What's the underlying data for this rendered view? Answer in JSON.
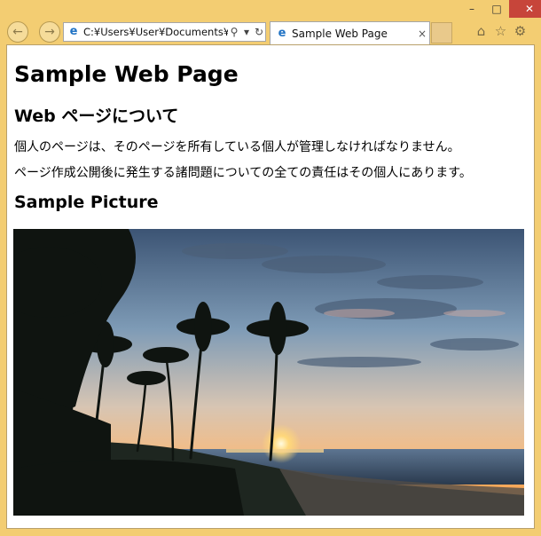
{
  "window": {
    "minimize_glyph": "–",
    "maximize_glyph": "□",
    "close_glyph": "✕"
  },
  "toolbar": {
    "back_icon": "back-arrow-icon",
    "forward_icon": "forward-arrow-icon",
    "address": "C:¥Users¥User¥Documents¥ir",
    "address_actions": [
      "search-icon",
      "dropdown-icon",
      "refresh-icon"
    ]
  },
  "tab": {
    "title": "Sample Web Page",
    "close_glyph": "×"
  },
  "right_icons": [
    "home-icon",
    "favorites-icon",
    "settings-icon"
  ],
  "page": {
    "heading": "Sample Web Page",
    "subheading": "Web ページについて",
    "paragraph1": "個人のページは、そのページを所有している個人が管理しなければなりません。",
    "paragraph2": "ページ作成公開後に発生する諸問題についての全ての責任はその個人にあります。",
    "picture_heading": "Sample Picture"
  },
  "colors": {
    "frame": "#f3cd72",
    "close_button": "#c7453a",
    "ie_blue": "#1f72c4"
  }
}
